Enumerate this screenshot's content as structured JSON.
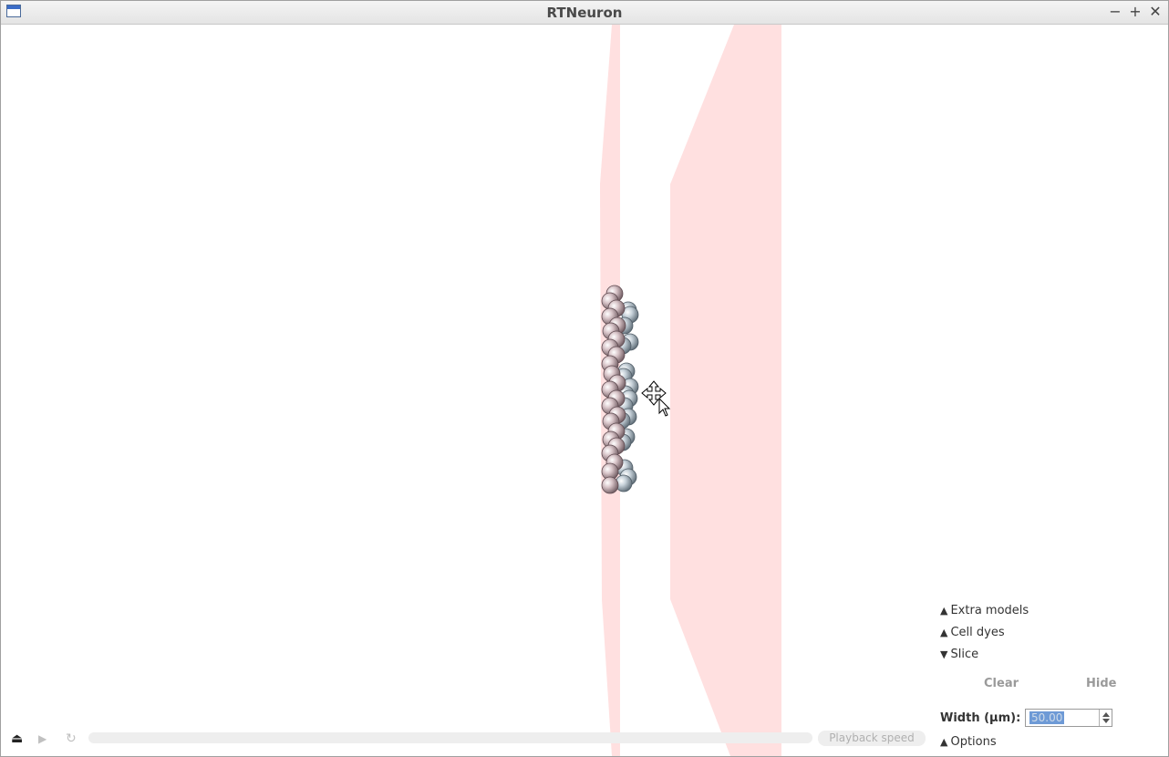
{
  "window": {
    "title": "RTNeuron",
    "minimize_glyph": "−",
    "maximize_glyph": "+",
    "close_glyph": "✕"
  },
  "panel": {
    "extra_models": {
      "arrow": "▲",
      "label": "Extra models"
    },
    "cell_dyes": {
      "arrow": "▲",
      "label": "Cell dyes"
    },
    "slice": {
      "arrow": "▼",
      "label": "Slice"
    },
    "clear_label": "Clear",
    "hide_label": "Hide",
    "width_label": "Width (µm):",
    "width_value": "50.00",
    "options": {
      "arrow": "▲",
      "label": "Options"
    }
  },
  "playback": {
    "eject_glyph": "⏏",
    "play_glyph": "▶",
    "loop_glyph": "↻",
    "progress_fraction": 0,
    "speed_label": "Playback speed"
  },
  "colors": {
    "slice_plane": "#ffe0e0",
    "soma_pink": "#c9b3b8",
    "soma_blue": "#b7c3cc",
    "selection": "#6e9ad6"
  },
  "icons": {
    "app": "app-window-icon",
    "cursor": "move-cursor-icon"
  }
}
